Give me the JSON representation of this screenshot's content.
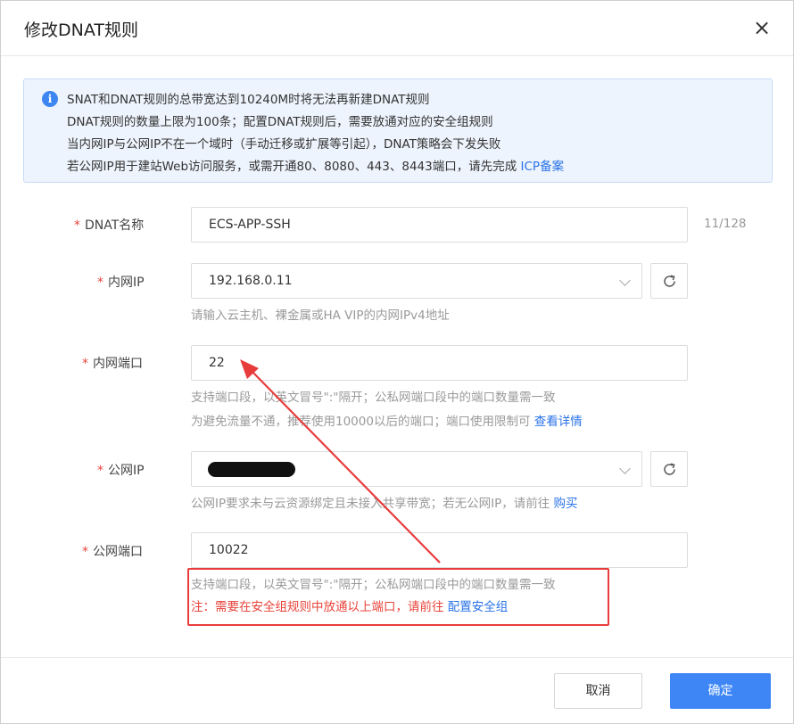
{
  "dialog": {
    "title": "修改DNAT规则",
    "close_icon": "close-icon"
  },
  "notice": {
    "icon": "info-icon",
    "icon_glyph": "i",
    "line1": "SNAT和DNAT规则的总带宽达到10240M时将无法再新建DNAT规则",
    "line2": "DNAT规则的数量上限为100条；配置DNAT规则后，需要放通对应的安全组规则",
    "line3": "当内网IP与公网IP不在一个域时（手动迁移或扩展等引起），DNAT策略会下发失败",
    "line4_text": "若公网IP用于建站Web访问服务，或需开通80、8080、443、8443端口，请先完成 ",
    "line4_link": "ICP备案"
  },
  "form": {
    "required_mark": "*",
    "dnat_name": {
      "label": "DNAT名称",
      "value": "ECS-APP-SSH",
      "counter": "11/128"
    },
    "private_ip": {
      "label": "内网IP",
      "value": "192.168.0.11",
      "hint": "请输入云主机、裸金属或HA VIP的内网IPv4地址"
    },
    "private_port": {
      "label": "内网端口",
      "value": "22",
      "hint1": "支持端口段，以英文冒号\":\"隔开；公私网端口段中的端口数量需一致",
      "hint2_text": "为避免流量不通，推荐使用10000以后的端口；端口使用限制可 ",
      "hint2_link": "查看详情"
    },
    "public_ip": {
      "label": "公网IP",
      "hint_text": "公网IP要求未与云资源绑定且未接入共享带宽；若无公网IP，请前往 ",
      "hint_link": "购买"
    },
    "public_port": {
      "label": "公网端口",
      "value": "10022",
      "hint1": "支持端口段，以英文冒号\":\"隔开；公私网端口段中的端口数量需一致",
      "warn_text": "注：需要在安全组规则中放通以上端口，请前往 ",
      "warn_link": "配置安全组"
    }
  },
  "footer": {
    "cancel_label": "取消",
    "ok_label": "确定"
  },
  "colors": {
    "primary": "#3e86f5",
    "link": "#2a73e8",
    "warning": "#e8443b",
    "annotation": "#e83c3c"
  }
}
